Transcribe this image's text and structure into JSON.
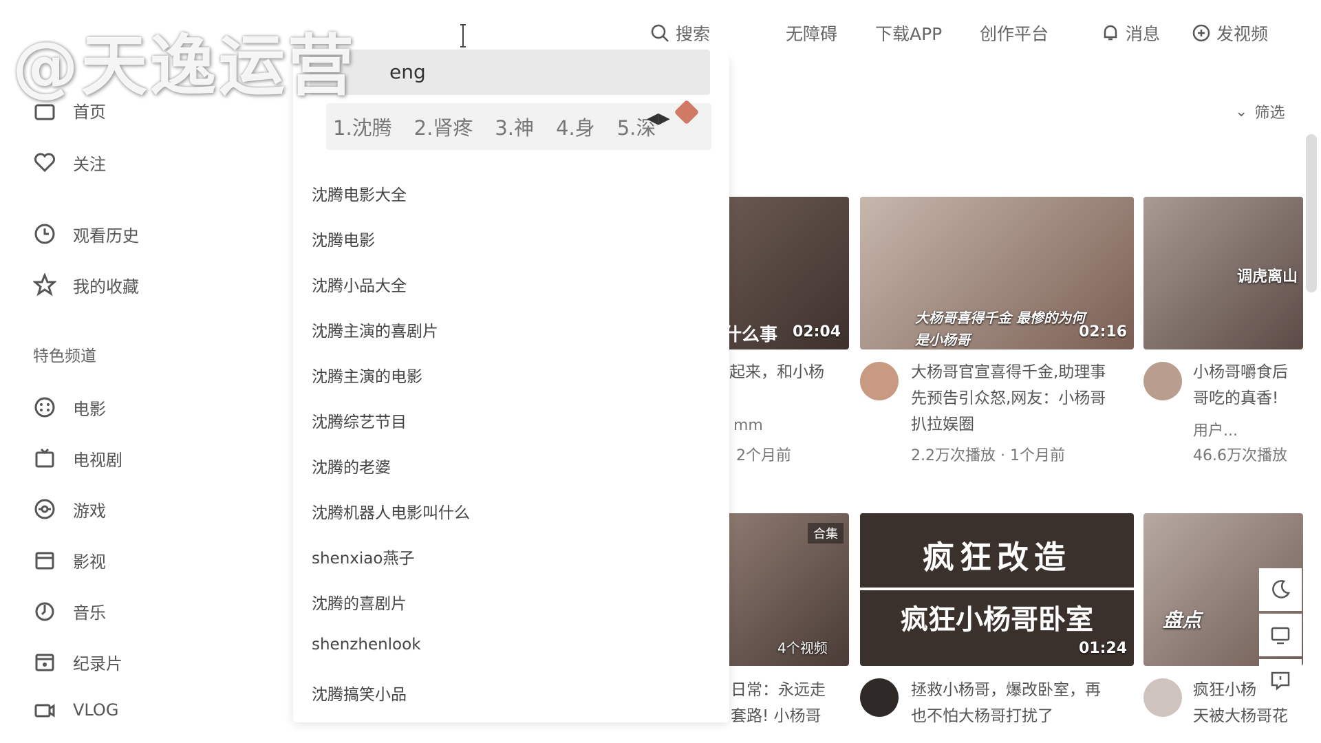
{
  "watermark": "@天逸运营",
  "header": {
    "search_button": "搜索",
    "links": [
      "无障碍",
      "下载APP",
      "创作平台",
      "消息",
      "发视频"
    ]
  },
  "search": {
    "input_partial": "eng",
    "ime_candidates": [
      "1.沈腾",
      "2.肾疼",
      "3.神",
      "4.身",
      "5.深"
    ],
    "suggestions": [
      "沈腾电影大全",
      "沈腾电影",
      "沈腾小品大全",
      "沈腾主演的喜剧片",
      "沈腾主演的电影",
      "沈腾综艺节目",
      "沈腾的老婆",
      "沈腾机器人电影叫什么",
      "shenxiao燕子",
      "沈腾的喜剧片",
      "shenzhenlook",
      "沈腾搞笑小品"
    ]
  },
  "sidebar": {
    "items": [
      {
        "label": "首页",
        "icon": "home-icon"
      },
      {
        "label": "关注",
        "icon": "heart-icon"
      },
      {
        "label": "观看历史",
        "icon": "clock-icon"
      },
      {
        "label": "我的收藏",
        "icon": "star-icon"
      }
    ],
    "section_title": "特色频道",
    "channels": [
      {
        "label": "电影",
        "icon": "film-icon"
      },
      {
        "label": "电视剧",
        "icon": "tv-icon"
      },
      {
        "label": "游戏",
        "icon": "game-icon"
      },
      {
        "label": "影视",
        "icon": "clapper-icon"
      },
      {
        "label": "音乐",
        "icon": "music-icon"
      },
      {
        "label": "纪录片",
        "icon": "documentary-icon"
      },
      {
        "label": "VLOG",
        "icon": "vlog-camera-icon"
      }
    ]
  },
  "filter_label": "筛选",
  "cards": [
    {
      "duration": "02:04",
      "thumb_text": "什么事",
      "title_lines": [
        "起来，和小杨",
        ""
      ],
      "author": "mm",
      "meta": "2个月前"
    },
    {
      "duration": "02:16",
      "thumb_text": "大杨哥喜得千金 最惨的为何是小杨哥",
      "title_lines": [
        "大杨哥官宣喜得千金,助理事",
        "先预告引众怒,网友：小杨哥",
        "扒拉娱圈"
      ],
      "meta": "2.2万次播放 · 1个月前"
    },
    {
      "duration": "",
      "thumb_text": "调虎离山",
      "title_lines": [
        "小杨哥嚼食后",
        "哥吃的真香!"
      ],
      "author": "用户...",
      "meta": "46.6万次播放"
    },
    {
      "duration": "",
      "thumb_text": "合集",
      "badge": "4个视频",
      "title_lines": [
        "日常：永远走",
        "套路! 小杨哥"
      ]
    },
    {
      "duration": "01:24",
      "thumb_text": "疯狂改造",
      "thumb_text2": "疯狂小杨哥卧室",
      "title_lines": [
        "拯救小杨哥，爆改卧室，再",
        "也不怕大杨哥打扰了"
      ]
    },
    {
      "duration": "",
      "thumb_text": "盘点",
      "title_lines": [
        "疯狂小杨",
        "天被大杨哥花"
      ]
    }
  ]
}
